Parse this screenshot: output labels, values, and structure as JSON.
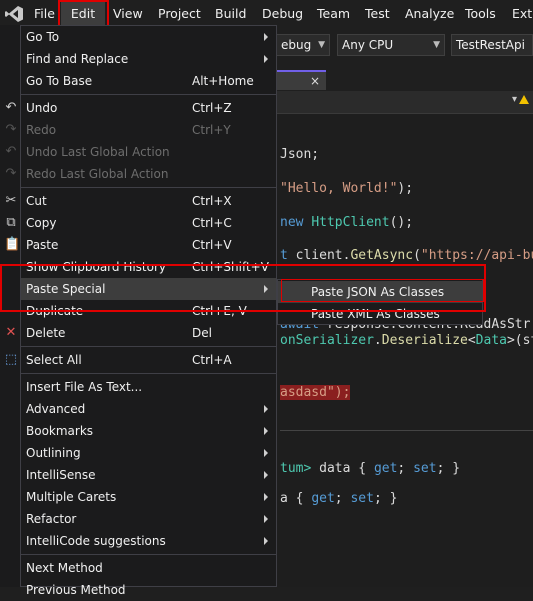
{
  "menubar": {
    "items": [
      "File",
      "Edit",
      "View",
      "Project",
      "Build",
      "Debug",
      "Team",
      "Test",
      "Analyze",
      "Tools",
      "Exte"
    ]
  },
  "toolbar": {
    "config": "ebug",
    "platform": "Any CPU",
    "startup_project": "TestRestApi"
  },
  "editor": {
    "tab_close": "×",
    "lines": {
      "l1_tail": "Json;",
      "l2_string": "\"Hello, World!\"",
      "l2_tail": ");",
      "l3_kw": "new",
      "l3_type": "HttpClient",
      "l3_tail": "();",
      "l4_a": "t",
      "l4_b": "client",
      "l4_c": ".",
      "l4_method": "GetAsync",
      "l4_d": "(",
      "l4_str": "\"https://api-bu",
      "l5_a": "await",
      "l5_b": " response.Content.ReadAsStr",
      "l6_a": "onSerializer",
      "l6_b": ".",
      "l6_method": "Deserialize",
      "l6_c": "<",
      "l6_type": "Data",
      "l6_d": ">(str",
      "l7_err": "asdasd\");",
      "l8_a": "tum>",
      "l8_b": " data { ",
      "l8_get": "get",
      "l8_c": "; ",
      "l8_set": "set",
      "l8_d": "; }",
      "l9_a": "a { ",
      "l9_get": "get",
      "l9_b": "; ",
      "l9_set": "set",
      "l9_c": "; }"
    }
  },
  "edit_menu": {
    "items": [
      {
        "label": "Go To",
        "shortcut": "",
        "submenu": true,
        "disabled": false
      },
      {
        "label": "Find and Replace",
        "shortcut": "",
        "submenu": true,
        "disabled": false
      },
      {
        "label": "Go To Base",
        "shortcut": "Alt+Home",
        "submenu": false,
        "disabled": false
      },
      {
        "label": "Undo",
        "shortcut": "Ctrl+Z",
        "submenu": false,
        "disabled": false
      },
      {
        "label": "Redo",
        "shortcut": "Ctrl+Y",
        "submenu": false,
        "disabled": true
      },
      {
        "label": "Undo Last Global Action",
        "shortcut": "",
        "submenu": false,
        "disabled": true
      },
      {
        "label": "Redo Last Global Action",
        "shortcut": "",
        "submenu": false,
        "disabled": true
      },
      {
        "label": "Cut",
        "shortcut": "Ctrl+X",
        "submenu": false,
        "disabled": false
      },
      {
        "label": "Copy",
        "shortcut": "Ctrl+C",
        "submenu": false,
        "disabled": false
      },
      {
        "label": "Paste",
        "shortcut": "Ctrl+V",
        "submenu": false,
        "disabled": false
      },
      {
        "label": "Show Clipboard History",
        "shortcut": "Ctrl+Shift+V",
        "submenu": false,
        "disabled": false
      },
      {
        "label": "Paste Special",
        "shortcut": "",
        "submenu": true,
        "disabled": false
      },
      {
        "label": "Duplicate",
        "shortcut": "Ctrl+E, V",
        "submenu": false,
        "disabled": false
      },
      {
        "label": "Delete",
        "shortcut": "Del",
        "submenu": false,
        "disabled": false
      },
      {
        "label": "Select All",
        "shortcut": "Ctrl+A",
        "submenu": false,
        "disabled": false
      },
      {
        "label": "Insert File As Text...",
        "shortcut": "",
        "submenu": false,
        "disabled": false
      },
      {
        "label": "Advanced",
        "shortcut": "",
        "submenu": true,
        "disabled": false
      },
      {
        "label": "Bookmarks",
        "shortcut": "",
        "submenu": true,
        "disabled": false
      },
      {
        "label": "Outlining",
        "shortcut": "",
        "submenu": true,
        "disabled": false
      },
      {
        "label": "IntelliSense",
        "shortcut": "",
        "submenu": true,
        "disabled": false
      },
      {
        "label": "Multiple Carets",
        "shortcut": "",
        "submenu": true,
        "disabled": false
      },
      {
        "label": "Refactor",
        "shortcut": "",
        "submenu": true,
        "disabled": false
      },
      {
        "label": "IntelliCode suggestions",
        "shortcut": "",
        "submenu": true,
        "disabled": false
      },
      {
        "label": "Next Method",
        "shortcut": "",
        "submenu": false,
        "disabled": false
      },
      {
        "label": "Previous Method",
        "shortcut": "",
        "submenu": false,
        "disabled": false
      }
    ]
  },
  "paste_special_menu": {
    "items": [
      "Paste JSON As Classes",
      "Paste XML As Classes"
    ]
  },
  "icons": {
    "undo": "↶",
    "redo": "↷",
    "cut": "✂",
    "copy": "⧉",
    "paste": "📋",
    "delete": "✕",
    "select_all": "⬚"
  },
  "colors": {
    "highlight_box": "#e00000",
    "hover": "#3d3d3d",
    "menu_bg": "#1b1b1c"
  }
}
